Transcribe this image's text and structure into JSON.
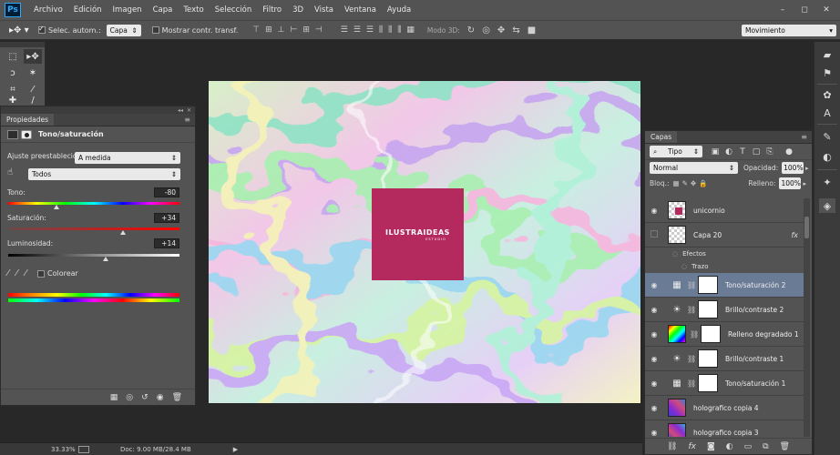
{
  "app": {
    "logo": "Ps",
    "menu": [
      "Archivo",
      "Edición",
      "Imagen",
      "Capa",
      "Texto",
      "Selección",
      "Filtro",
      "3D",
      "Vista",
      "Ventana",
      "Ayuda"
    ],
    "window_controls": [
      "–",
      "◻",
      "✕"
    ]
  },
  "options": {
    "auto_select_label": "Selec. autom.:",
    "auto_select_checked": true,
    "auto_select_value": "Capa",
    "show_transform_label": "Mostrar contr. transf.",
    "show_transform_checked": false,
    "mode3d_label": "Modo 3D:",
    "workspace": "Movimiento"
  },
  "properties": {
    "tab": "Propiedades",
    "title": "Tono/saturación",
    "preset_label": "Ajuste preestablecido:",
    "preset_value": "A medida",
    "channel_value": "Todos",
    "hue_label": "Tono:",
    "hue_value": "-80",
    "hue_level": 0.28,
    "sat_label": "Saturación:",
    "sat_value": "+34",
    "sat_level": 0.67,
    "light_label": "Luminosidad:",
    "light_value": "+14",
    "light_level": 0.57,
    "colorize_label": "Colorear",
    "colorize_checked": false
  },
  "canvas": {
    "logo_text": "ILUSTRAIDEAS",
    "logo_sub": "ESTUDIO",
    "logo_color": "#b52a5e"
  },
  "status": {
    "zoom": "33.33%",
    "doc": "Doc: 9.00 MB/28.4 MB"
  },
  "layers_panel": {
    "tab": "Capas",
    "filter_value": "Tipo",
    "blend_mode": "Normal",
    "opacity_label": "Opacidad:",
    "opacity_value": "100%",
    "lock_label": "Bloq.:",
    "fill_label": "Relleno:",
    "fill_value": "100%",
    "effects_label": "Efectos",
    "stroke_label": "Trazo",
    "layers": [
      {
        "name": "unicornio",
        "kind": "pixel",
        "visible": true
      },
      {
        "name": "Capa 20",
        "kind": "pixel",
        "visible": false,
        "fx": "fx"
      },
      {
        "name": "Tono/saturación 2",
        "kind": "huesat",
        "visible": true,
        "selected": true
      },
      {
        "name": "Brillo/contraste 2",
        "kind": "brightness",
        "visible": true
      },
      {
        "name": "Relleno degradado 1",
        "kind": "gradient",
        "visible": true
      },
      {
        "name": "Brillo/contraste 1",
        "kind": "brightness",
        "visible": true
      },
      {
        "name": "Tono/saturación 1",
        "kind": "huesat",
        "visible": true
      },
      {
        "name": "holografico copia 4",
        "kind": "holo",
        "visible": true
      },
      {
        "name": "holografico copia 3",
        "kind": "holo",
        "visible": true
      }
    ]
  }
}
